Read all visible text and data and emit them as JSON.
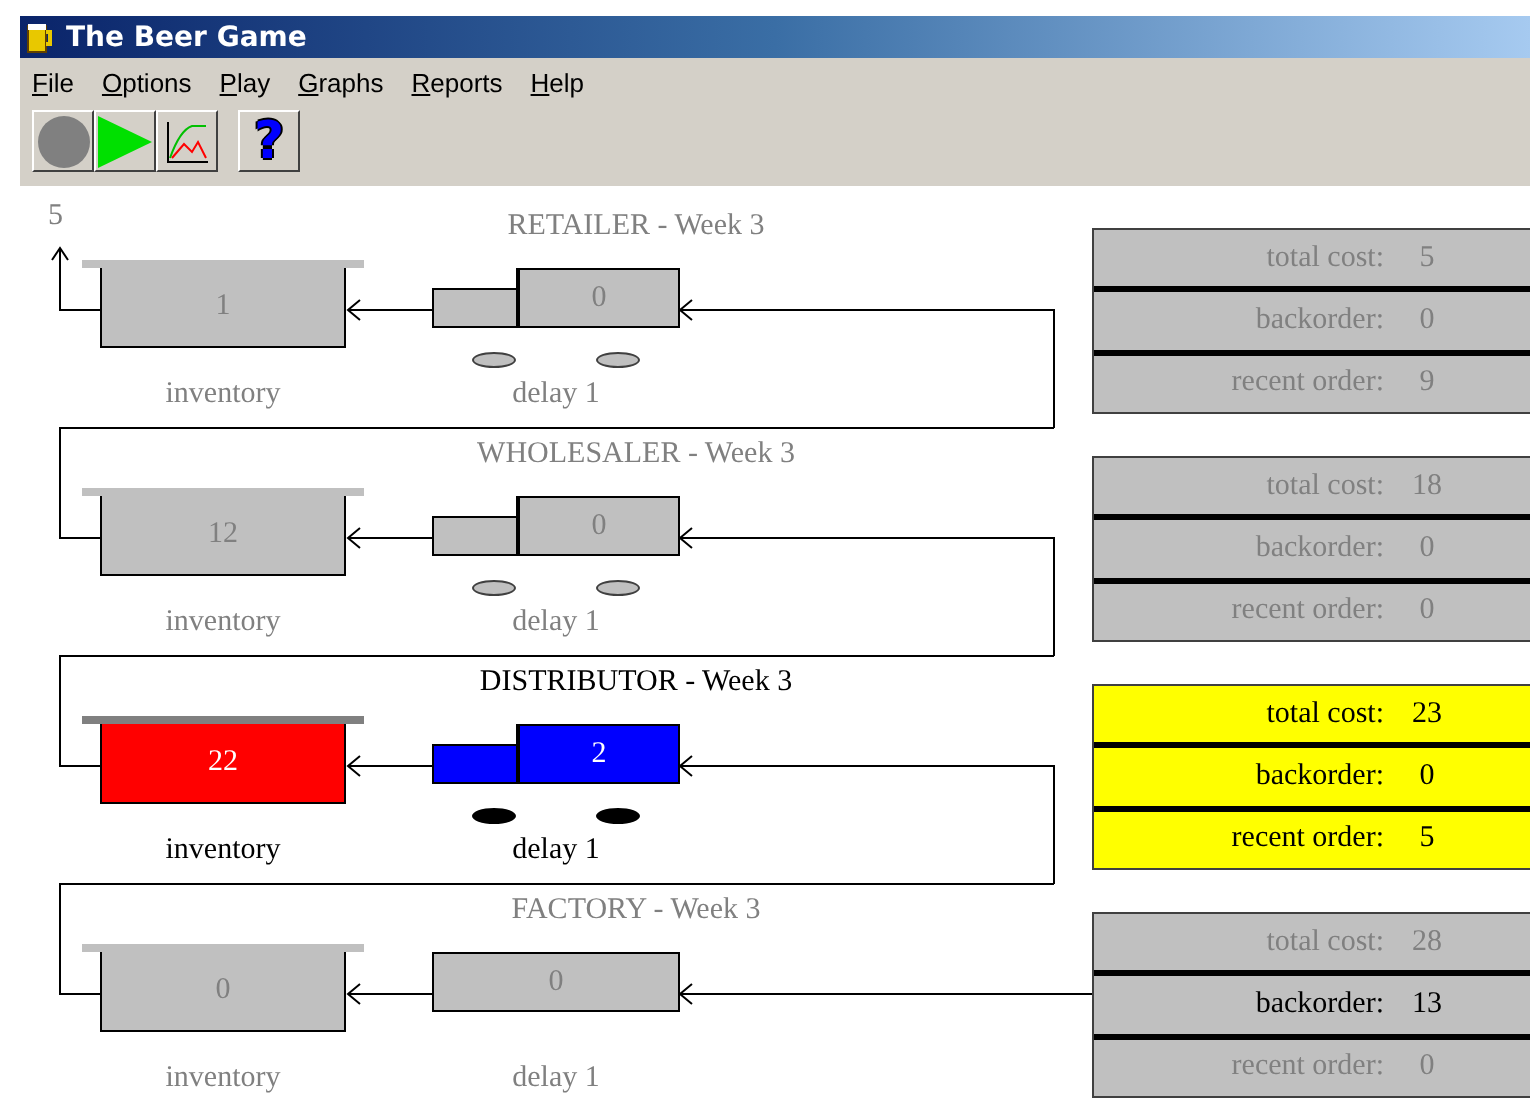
{
  "window": {
    "title": "The Beer Game"
  },
  "menu": [
    "File",
    "Options",
    "Play",
    "Graphs",
    "Reports",
    "Help"
  ],
  "toolbar": [
    {
      "kind": "stop"
    },
    {
      "kind": "play"
    },
    {
      "kind": "graph"
    },
    {
      "kind": "help",
      "label": "?"
    }
  ],
  "customer_shipment": "5",
  "stages": [
    {
      "title": "RETAILER - Week 3",
      "active": false,
      "kind": "truck",
      "inventory": "1",
      "inventory_label": "inventory",
      "in_transit": "0",
      "delay_label": "delay 1",
      "stats": [
        {
          "label": "total cost:",
          "value": "5",
          "emphasized": false
        },
        {
          "label": "backorder:",
          "value": "0",
          "emphasized": false
        },
        {
          "label": "recent order:",
          "value": "9",
          "emphasized": false
        }
      ]
    },
    {
      "title": "WHOLESALER - Week 3",
      "active": false,
      "kind": "truck",
      "inventory": "12",
      "inventory_label": "inventory",
      "in_transit": "0",
      "delay_label": "delay 1",
      "stats": [
        {
          "label": "total cost:",
          "value": "18",
          "emphasized": false
        },
        {
          "label": "backorder:",
          "value": "0",
          "emphasized": false
        },
        {
          "label": "recent order:",
          "value": "0",
          "emphasized": false
        }
      ]
    },
    {
      "title": "DISTRIBUTOR - Week 3",
      "active": true,
      "kind": "truck",
      "inventory": "22",
      "inventory_label": "inventory",
      "in_transit": "2",
      "delay_label": "delay 1",
      "stats": [
        {
          "label": "total cost:",
          "value": "23",
          "emphasized": true
        },
        {
          "label": "backorder:",
          "value": "0",
          "emphasized": true
        },
        {
          "label": "recent order:",
          "value": "5",
          "emphasized": true
        }
      ]
    },
    {
      "title": "FACTORY - Week 3",
      "active": false,
      "kind": "plant",
      "inventory": "0",
      "inventory_label": "inventory",
      "in_transit": "0",
      "delay_label": "delay 1",
      "stats": [
        {
          "label": "total cost:",
          "value": "28",
          "emphasized": false
        },
        {
          "label": "backorder:",
          "value": "13",
          "emphasized": true
        },
        {
          "label": "recent order:",
          "value": "0",
          "emphasized": false
        }
      ]
    }
  ]
}
